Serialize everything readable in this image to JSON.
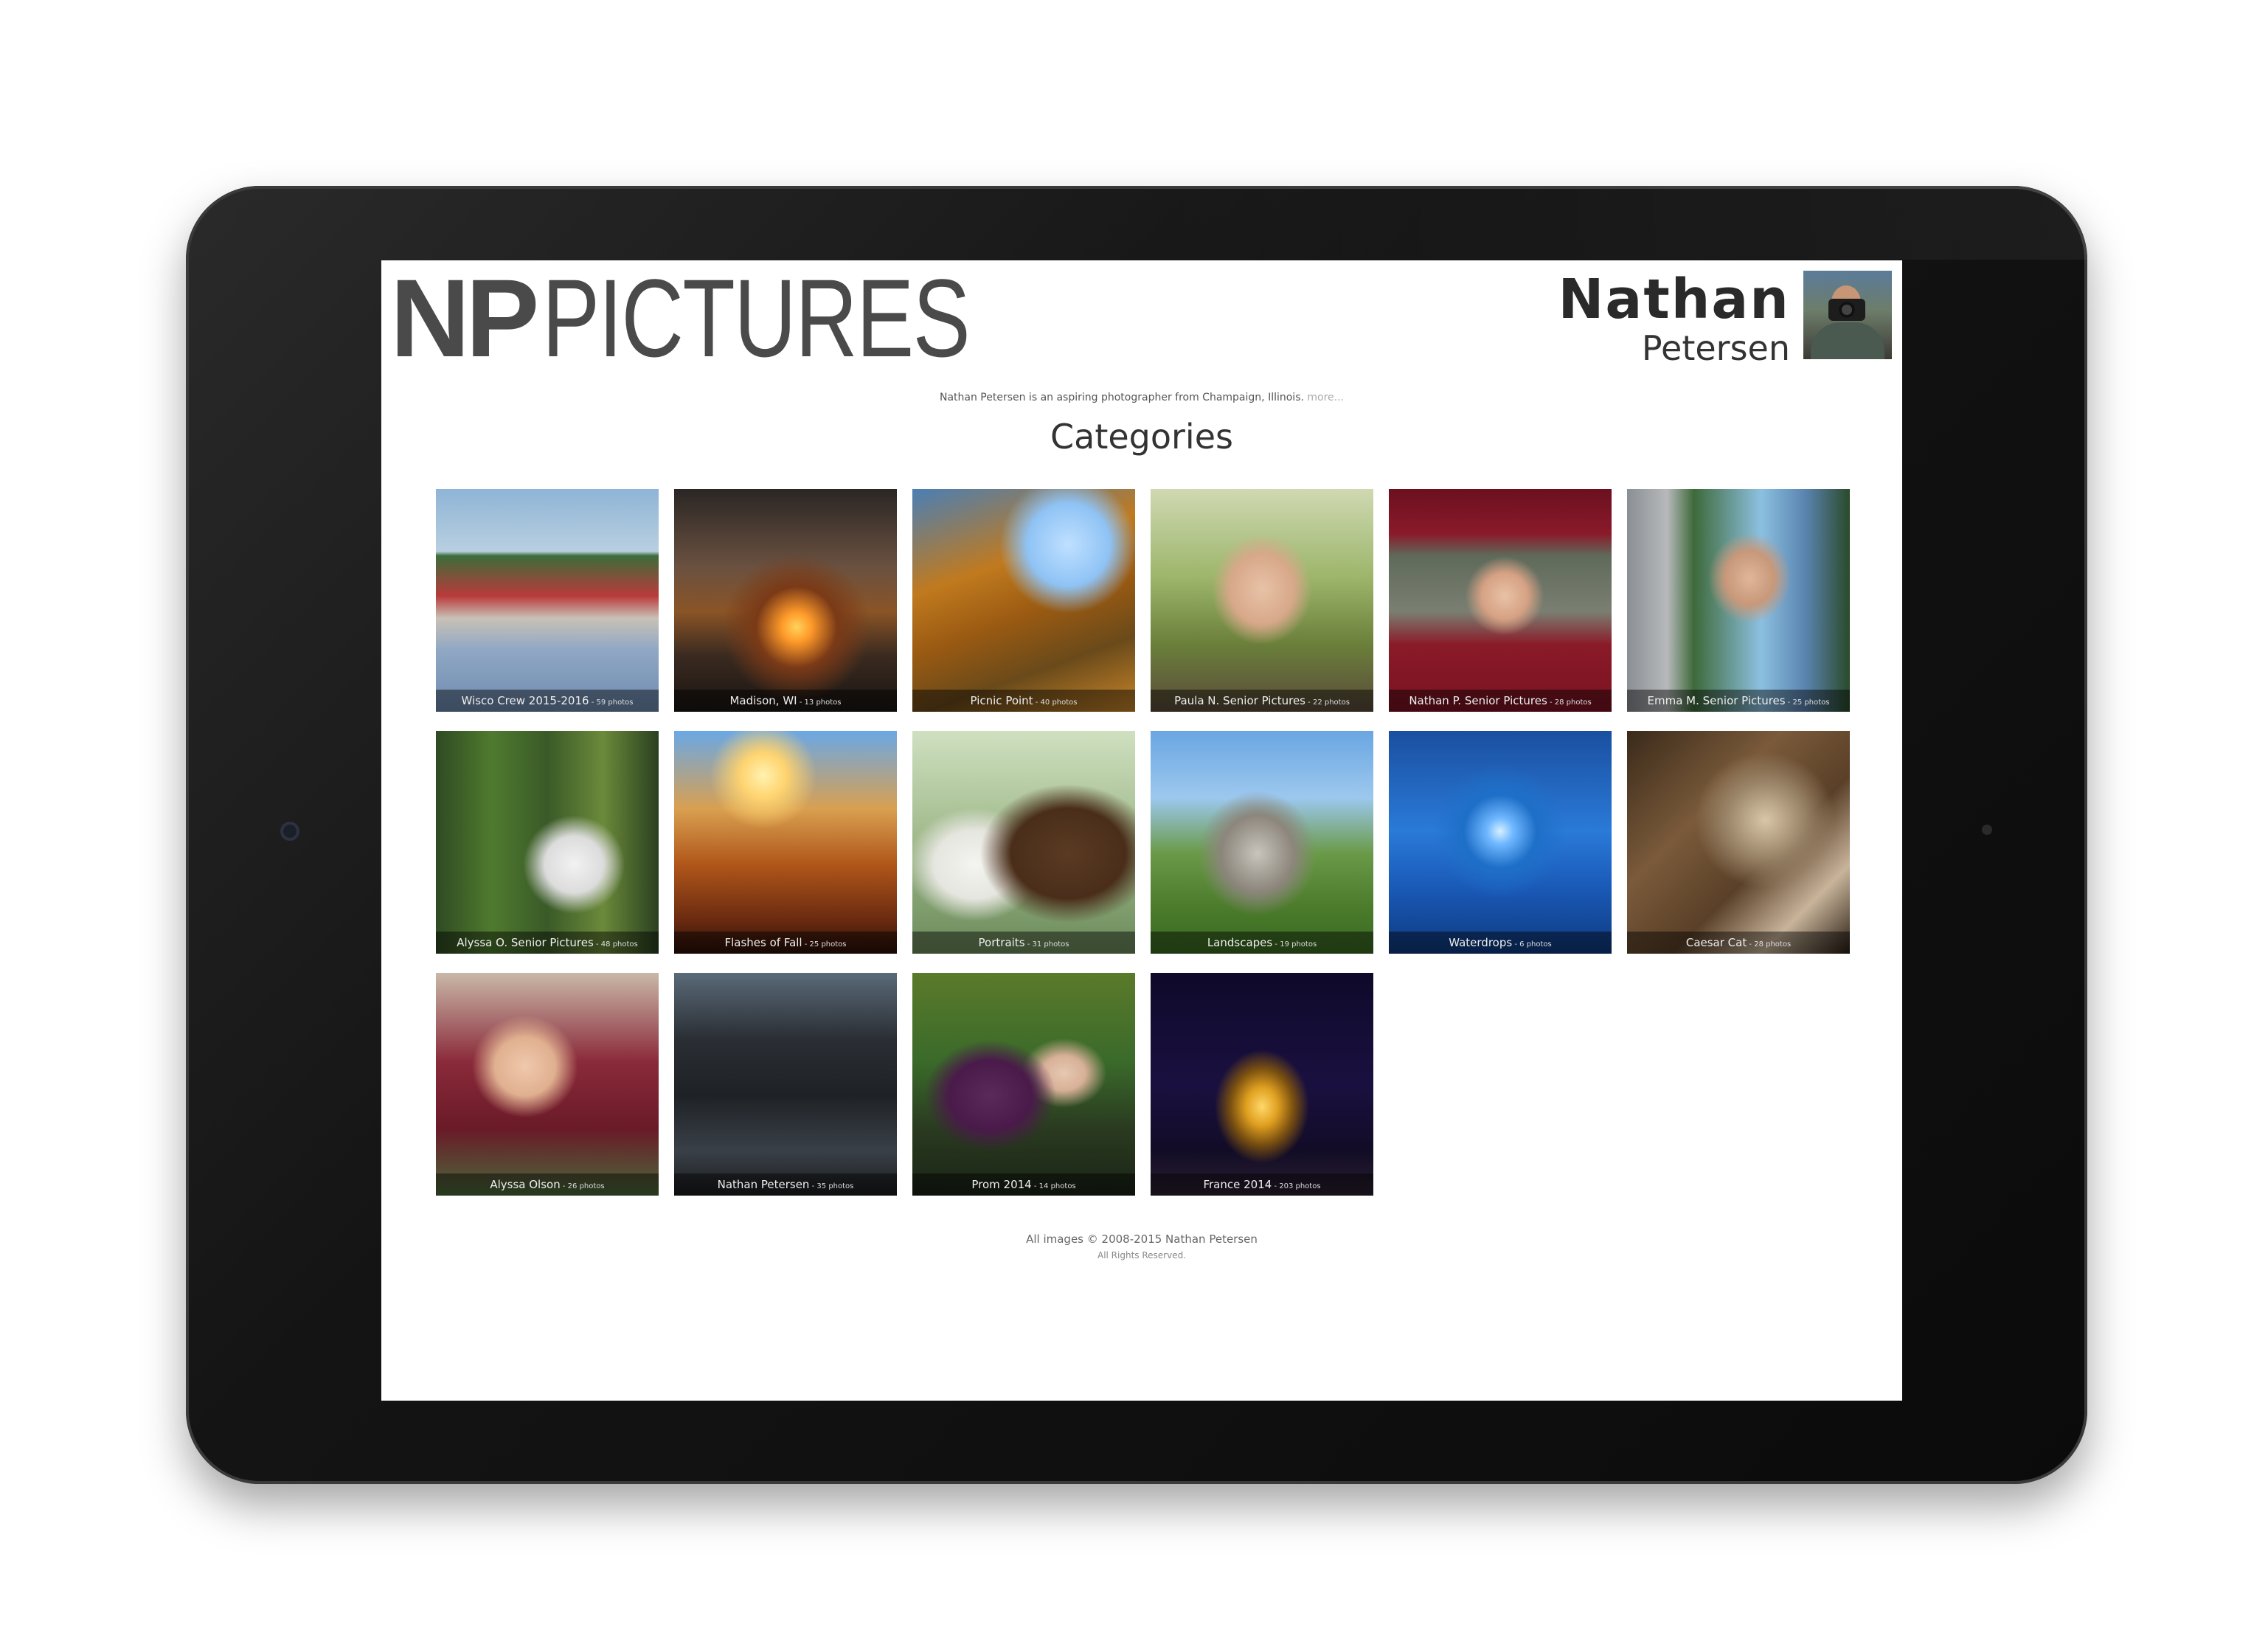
{
  "header": {
    "logo_bold": "NP",
    "logo_light": "PICTURES",
    "author_first": "Nathan",
    "author_last": "Petersen"
  },
  "intro": {
    "text": "Nathan Petersen is an aspiring photographer from Champaign, Illinois.",
    "more_link": "more..."
  },
  "categories_title": "Categories",
  "categories": [
    {
      "name": "Wisco Crew 2015-2016",
      "count": " - 59 photos"
    },
    {
      "name": "Madison, WI",
      "count": " - 13 photos"
    },
    {
      "name": "Picnic Point",
      "count": " - 40 photos"
    },
    {
      "name": "Paula N. Senior Pictures",
      "count": " - 22 photos"
    },
    {
      "name": "Nathan P. Senior Pictures",
      "count": " - 28 photos"
    },
    {
      "name": "Emma M. Senior Pictures",
      "count": " - 25 photos"
    },
    {
      "name": "Alyssa O. Senior Pictures",
      "count": " - 48 photos"
    },
    {
      "name": "Flashes of Fall",
      "count": " - 25 photos"
    },
    {
      "name": "Portraits",
      "count": " - 31 photos"
    },
    {
      "name": "Landscapes",
      "count": " - 19 photos"
    },
    {
      "name": "Waterdrops",
      "count": " - 6 photos"
    },
    {
      "name": "Caesar Cat",
      "count": " - 28 photos"
    },
    {
      "name": "Alyssa Olson",
      "count": " - 26 photos"
    },
    {
      "name": "Nathan Petersen",
      "count": " - 35 photos"
    },
    {
      "name": "Prom 2014",
      "count": " - 14 photos"
    },
    {
      "name": "France 2014",
      "count": " - 203 photos"
    }
  ],
  "footer": {
    "copyright": "All images © 2008-2015 Nathan Petersen",
    "rights": "All Rights Reserved."
  }
}
